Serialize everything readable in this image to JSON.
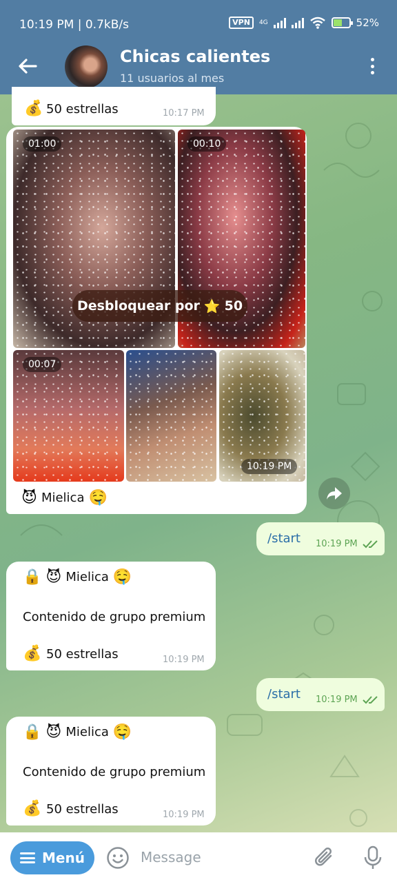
{
  "status_bar": {
    "time_speed": "10:19 PM | 0.7kB/s",
    "vpn": "VPN",
    "network": "4G",
    "battery": "52%"
  },
  "header": {
    "title": "Chicas calientes",
    "subtitle": "11 usuarios al mes"
  },
  "messages": {
    "m1": {
      "stars_icon": "💰",
      "stars_text": "50 estrellas",
      "time": "10:17 PM"
    },
    "album": {
      "durations": [
        "01:00",
        "00:10",
        "00:07"
      ],
      "unlock_label": "Desbloquear por",
      "unlock_star": "⭐",
      "unlock_amount": "50",
      "time": "10:19 PM",
      "caption_icon": "😈",
      "caption": "Mielica",
      "caption_emoji": "🤤"
    },
    "out1": {
      "text": "/start",
      "time": "10:19 PM"
    },
    "m2": {
      "lock": "🔒",
      "devil": "😈",
      "name": "Mielica",
      "emoji": "🤤",
      "body": "Contenido de grupo premium",
      "stars_icon": "💰",
      "stars_text": "50 estrellas",
      "time": "10:19 PM"
    },
    "out2": {
      "text": "/start",
      "time": "10:19 PM"
    },
    "m3": {
      "lock": "🔒",
      "devil": "😈",
      "name": "Mielica",
      "emoji": "🤤",
      "body": "Contenido de grupo premium",
      "stars_icon": "💰",
      "stars_text": "50 estrellas",
      "time": "10:19 PM"
    }
  },
  "input_bar": {
    "menu_label": "Menú",
    "placeholder": "Message"
  },
  "colors": {
    "header_bg": "#527da3",
    "menu_button": "#4a9bdc",
    "outgoing_bubble": "#effdde"
  }
}
